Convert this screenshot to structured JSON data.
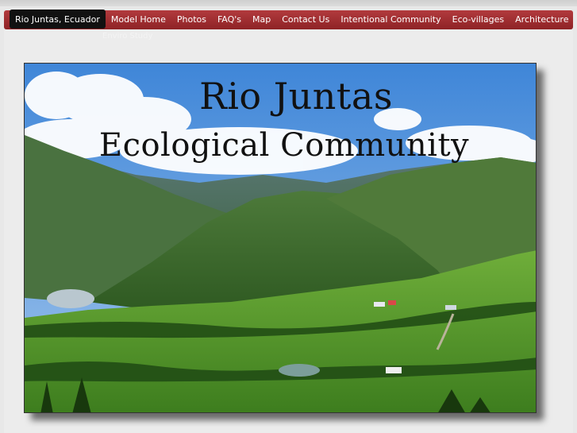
{
  "nav": {
    "items": [
      {
        "label": "Rio Juntas, Ecuador",
        "active": true
      },
      {
        "label": "Model Home"
      },
      {
        "label": "Photos"
      },
      {
        "label": "FAQ's"
      },
      {
        "label": "Map"
      },
      {
        "label": "Contact Us"
      },
      {
        "label": "Intentional Community"
      },
      {
        "label": "Eco-villages"
      },
      {
        "label": "Architecture"
      }
    ],
    "overflow_item": "Enviro Study"
  },
  "hero": {
    "title_line1": "Rio Juntas",
    "title_line2": "Ecological Community"
  },
  "colors": {
    "nav_red": "#9e2d30",
    "active_tab": "#111111",
    "background": "#e8e8e8"
  }
}
